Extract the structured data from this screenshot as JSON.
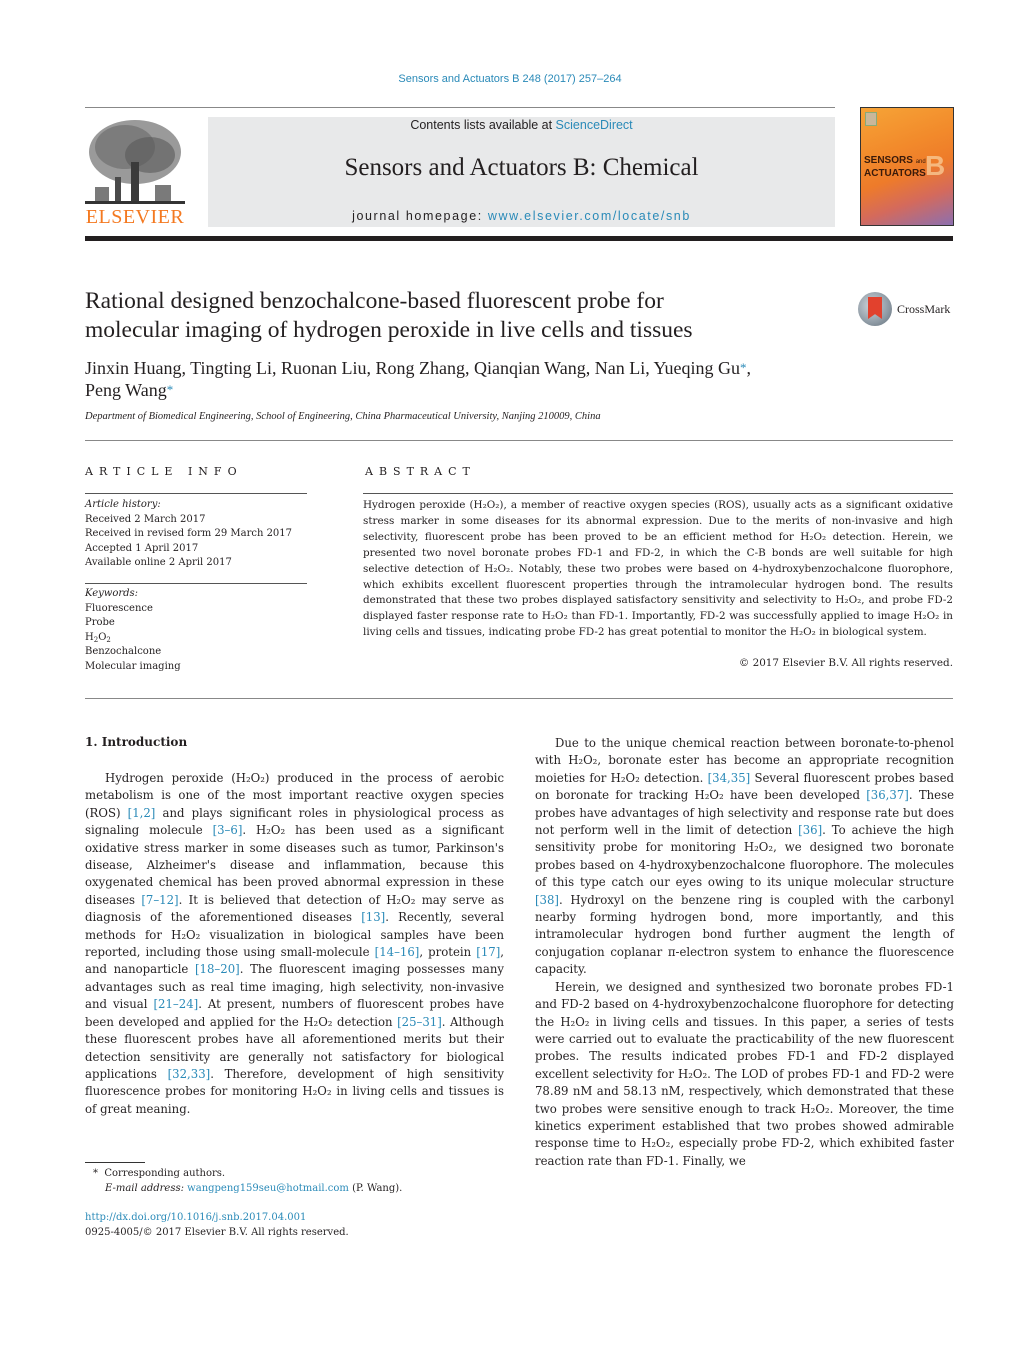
{
  "header": {
    "journal_ref": "Sensors and Actuators B 248 (2017) 257–264",
    "contents_prefix": "Contents lists available at ",
    "contents_link": "ScienceDirect",
    "journal_title": "Sensors and Actuators B: Chemical",
    "homepage_prefix": "journal homepage: ",
    "homepage_link": "www.elsevier.com/locate/snb",
    "publisher_logo_text": "ELSEVIER",
    "cover_title_line1": "SENSORS",
    "cover_title_and": "and",
    "cover_title_line2": "ACTUATORS",
    "cover_big_letter": "B",
    "crossmark_label": "CrossMark",
    "brand_color": "#f47920",
    "link_color": "#2a8ab8"
  },
  "article": {
    "title_line1": "Rational designed benzochalcone-based fluorescent probe for",
    "title_line2": "molecular imaging of hydrogen peroxide in live cells and tissues",
    "authors_line1": "Jinxin Huang, Tingting Li, Ruonan Liu, Rong Zhang, Qianqian Wang, Nan Li, Yueqing Gu",
    "authors_line2": "Peng Wang",
    "corresponding_mark": "*",
    "affiliation": "Department of Biomedical Engineering, School of Engineering, China Pharmaceutical University, Nanjing 210009, China"
  },
  "article_info": {
    "heading": "ARTICLE INFO",
    "history_label": "Article history:",
    "history": [
      "Received 2 March 2017",
      "Received in revised form 29 March 2017",
      "Accepted 1 April 2017",
      "Available online 2 April 2017"
    ],
    "keywords_label": "Keywords:",
    "keywords": [
      "Fluorescence",
      "Probe",
      "H2O2",
      "Benzochalcone",
      "Molecular imaging"
    ]
  },
  "abstract": {
    "heading": "ABSTRACT",
    "text": "Hydrogen peroxide (H₂O₂), a member of reactive oxygen species (ROS), usually acts as a significant oxidative stress marker in some diseases for its abnormal expression. Due to the merits of non-invasive and high selectivity, fluorescent probe has been proved to be an efficient method for H₂O₂ detection. Herein, we presented two novel boronate probes FD-1 and FD-2, in which the C-B bonds are well suitable for high selective detection of H₂O₂. Notably, these two probes were based on 4-hydroxybenzochalcone fluorophore, which exhibits excellent fluorescent properties through the intramolecular hydrogen bond. The results demonstrated that these two probes displayed satisfactory sensitivity and selectivity to H₂O₂, and probe FD-2 displayed faster response rate to H₂O₂ than FD-1. Importantly, FD-2 was successfully applied to image H₂O₂ in living cells and tissues, indicating probe FD-2 has great potential to monitor the H₂O₂ in biological system.",
    "copyright": "© 2017 Elsevier B.V. All rights reserved."
  },
  "body": {
    "intro_heading": "1.  Introduction",
    "left_paragraphs": [
      [
        {
          "t": "Hydrogen peroxide (H₂O₂) produced in the process of aerobic metabolism is one of the most important reactive oxygen species (ROS) "
        },
        {
          "r": "[1,2]"
        },
        {
          "t": " and plays significant roles in physiological process as signaling molecule "
        },
        {
          "r": "[3–6]"
        },
        {
          "t": ". H₂O₂ has been used as a significant oxidative stress marker in some diseases such as tumor, Parkinson's disease, Alzheimer's disease and inflammation, because this oxygenated chemical has been proved abnormal expression in these diseases "
        },
        {
          "r": "[7–12]"
        },
        {
          "t": ". It is believed that detection of H₂O₂ may serve as diagnosis of the aforementioned diseases "
        },
        {
          "r": "[13]"
        },
        {
          "t": ". Recently, several methods for H₂O₂ visualization in biological samples have been reported, including those using small-molecule "
        },
        {
          "r": "[14–16]"
        },
        {
          "t": ", protein "
        },
        {
          "r": "[17]"
        },
        {
          "t": ", and nanoparticle "
        },
        {
          "r": "[18–20]"
        },
        {
          "t": ". The fluorescent imaging possesses many advantages such as real time imaging, high selectivity, non-invasive and visual "
        },
        {
          "r": "[21–24]"
        },
        {
          "t": ". At present, numbers of fluorescent probes have been developed and applied for the H₂O₂ detection "
        },
        {
          "r": "[25–31]"
        },
        {
          "t": ". Although these fluorescent probes have all aforementioned merits but their detection sensitivity are generally not satisfactory for biological applications "
        },
        {
          "r": "[32,33]"
        },
        {
          "t": ". Therefore, development of high sensitivity fluorescence probes for monitoring H₂O₂ in living cells and tissues is of great meaning."
        }
      ]
    ],
    "right_paragraphs": [
      [
        {
          "t": "Due to the unique chemical reaction between boronate-to-phenol with H₂O₂, boronate ester has become an appropriate recognition moieties for H₂O₂ detection. "
        },
        {
          "r": "[34,35]"
        },
        {
          "t": " Several fluorescent probes based on boronate for tracking H₂O₂ have been developed "
        },
        {
          "r": "[36,37]"
        },
        {
          "t": ". These probes have advantages of high selectivity and response rate but does not perform well in the limit of detection "
        },
        {
          "r": "[36]"
        },
        {
          "t": ". To achieve the high sensitivity probe for monitoring H₂O₂, we designed two boronate probes based on 4-hydroxybenzochalcone fluorophore. The molecules of this type catch our eyes owing to its unique molecular structure "
        },
        {
          "r": "[38]"
        },
        {
          "t": ". Hydroxyl on the benzene ring is coupled with the carbonyl nearby forming hydrogen bond, more importantly, and this intramolecular hydrogen bond further augment the length of conjugation coplanar π-electron system to enhance the fluorescence capacity."
        }
      ],
      [
        {
          "t": "Herein, we designed and synthesized two boronate probes FD-1 and FD-2 based on 4-hydroxybenzochalcone fluorophore for detecting the H₂O₂ in living cells and tissues. In this paper, a series of tests were carried out to evaluate the practicability of the new fluorescent probes. The results indicated probes FD-1 and FD-2 displayed excellent selectivity for H₂O₂. The LOD of probes FD-1 and FD-2 were 78.89 nM and 58.13 nM, respectively, which demonstrated that these two probes were sensitive enough to track H₂O₂. Moreover, the time kinetics experiment established that two probes showed admirable response time to H₂O₂, especially probe FD-2, which exhibited faster reaction rate than FD-1. Finally, we"
        }
      ]
    ]
  },
  "footer": {
    "footnote_mark": "*",
    "footnote_text": "Corresponding authors.",
    "email_label": "E-mail address:",
    "email": "wangpeng159seu@hotmail.com",
    "email_owner": " (P. Wang).",
    "doi_link": "http://dx.doi.org/10.1016/j.snb.2017.04.001",
    "issn_copyright": "0925-4005/© 2017 Elsevier B.V. All rights reserved."
  }
}
